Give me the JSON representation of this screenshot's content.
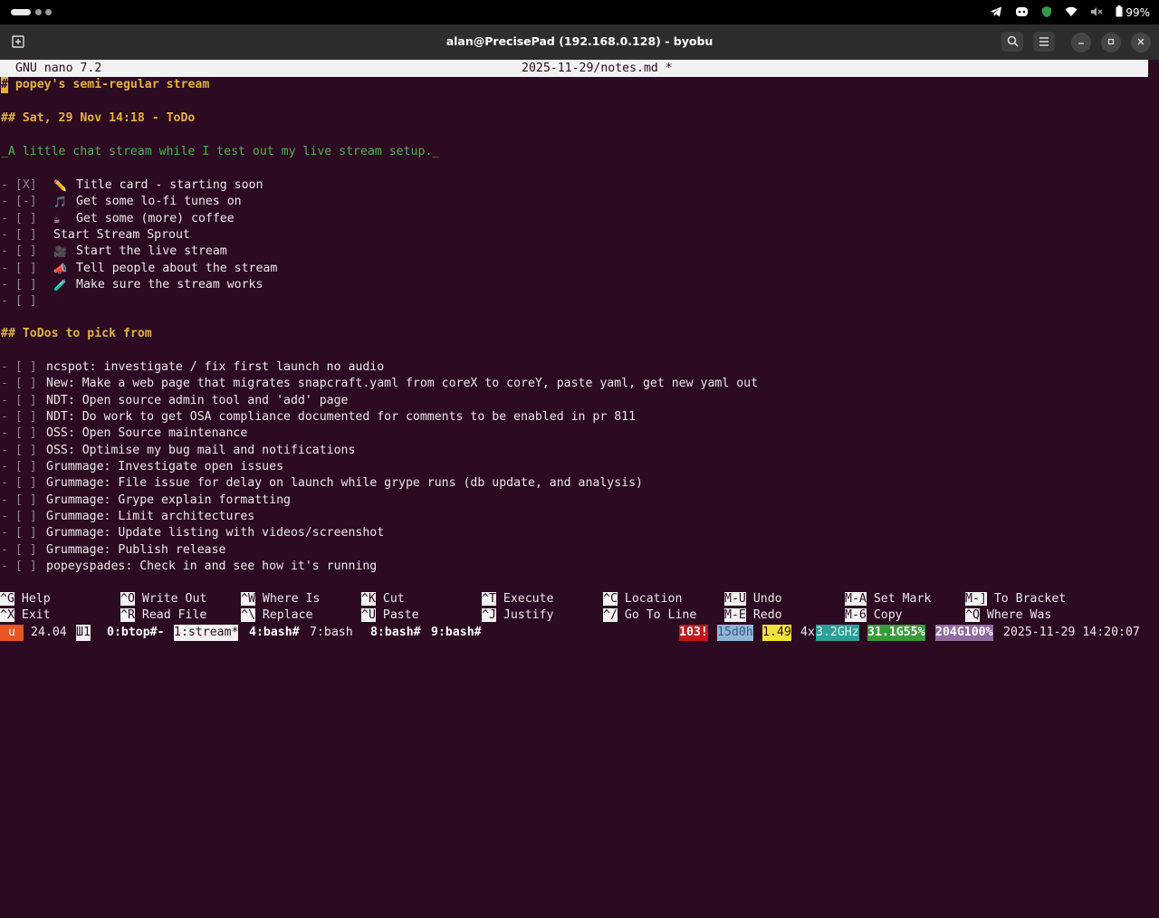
{
  "window": {
    "title": "alan@PrecisePad (192.168.0.128) - byobu"
  },
  "tray": {
    "battery": "99%"
  },
  "nano": {
    "version": "GNU nano 7.2",
    "filename": "2025-11-29/notes.md *"
  },
  "doc": {
    "h1_mark": "#",
    "h1_text": " popey's semi-regular stream",
    "h2_date": "## Sat, 29 Nov 14:18 - ToDo",
    "italic": "_A little chat stream while I test out my live stream setup._",
    "checklist": [
      {
        "box": "- [X]",
        "icon": "✏️",
        "text": "Title card - starting soon"
      },
      {
        "box": "- [-]",
        "icon": "🎵",
        "text": "Get some lo-fi tunes on"
      },
      {
        "box": "- [ ]",
        "icon": "☕",
        "text": "Get some (more) coffee"
      },
      {
        "box": "- [ ]",
        "icon": "",
        "text": "Start Stream Sprout"
      },
      {
        "box": "- [ ]",
        "icon": "🎥",
        "text": "Start the live stream"
      },
      {
        "box": "- [ ]",
        "icon": "📣",
        "text": "Tell people about the stream"
      },
      {
        "box": "- [ ]",
        "icon": "🧪",
        "text": "Make sure the stream works"
      },
      {
        "box": "- [ ]",
        "icon": "",
        "text": ""
      }
    ],
    "h2_todos": "## ToDos to pick from",
    "todos": [
      "ncspot: investigate / fix first launch no audio",
      "New: Make a web page that migrates snapcraft.yaml from coreX to coreY, paste yaml, get new yaml out",
      "NDT: Open source admin tool and 'add' page",
      "NDT: Do work to get OSA compliance documented for comments to be enabled in pr 811",
      "OSS: Open Source maintenance",
      "OSS: Optimise my bug mail and notifications",
      "Grummage: Investigate open issues",
      "Grummage: File issue for delay on launch while grype runs (db update, and analysis)",
      "Grummage: Grype explain formatting",
      "Grummage: Limit architectures",
      "Grummage: Update listing with videos/screenshot",
      "Grummage: Publish release",
      "popeyspades: Check in and see how it's running"
    ],
    "todo_box": "- [ ]"
  },
  "shortcuts": {
    "row1": [
      {
        "key": "^G",
        "label": "Help"
      },
      {
        "key": "^O",
        "label": "Write Out"
      },
      {
        "key": "^W",
        "label": "Where Is"
      },
      {
        "key": "^K",
        "label": "Cut"
      },
      {
        "key": "^T",
        "label": "Execute"
      },
      {
        "key": "^C",
        "label": "Location"
      },
      {
        "key": "M-U",
        "label": "Undo"
      },
      {
        "key": "M-A",
        "label": "Set Mark"
      },
      {
        "key": "M-]",
        "label": "To Bracket"
      }
    ],
    "row2": [
      {
        "key": "^X",
        "label": "Exit"
      },
      {
        "key": "^R",
        "label": "Read File"
      },
      {
        "key": "^\\",
        "label": "Replace"
      },
      {
        "key": "^U",
        "label": "Paste"
      },
      {
        "key": "^J",
        "label": "Justify"
      },
      {
        "key": "^/",
        "label": "Go To Line"
      },
      {
        "key": "M-E",
        "label": "Redo"
      },
      {
        "key": "M-6",
        "label": "Copy"
      },
      {
        "key": "^Q",
        "label": "Where Was"
      }
    ]
  },
  "status": {
    "distro_badge": "u",
    "release": "24.04",
    "session_icon": "Ш1",
    "windows": [
      "0:btop#-",
      "1:stream*",
      "4:bash#",
      "7:bash",
      "8:bash#",
      "9:bash#"
    ],
    "updates": "103!",
    "uptime": "15d0h",
    "load": "1.49",
    "cpu_count": "4x",
    "cpu_freq": "3.2GHz",
    "mem": "31.1G55%",
    "disk": "204G100%",
    "datetime": "2025-11-29 14:20:07"
  },
  "colors": {
    "terminal_bg": "#2c0a22",
    "heading": "#e3b23c",
    "italic": "#4ab54a",
    "status_orange": "#e95420"
  }
}
